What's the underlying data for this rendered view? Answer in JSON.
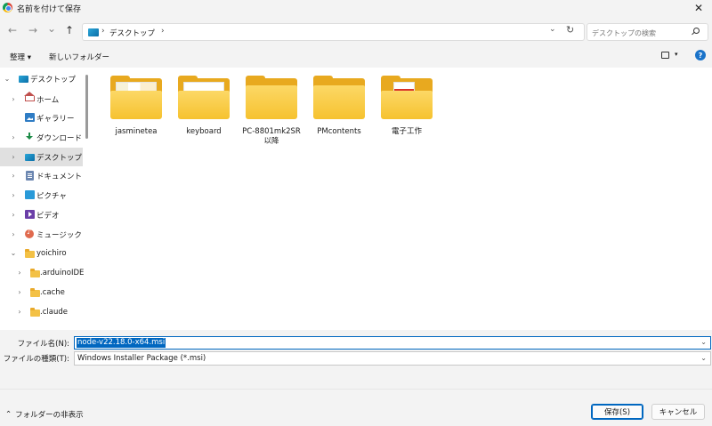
{
  "window": {
    "title": "名前を付けて保存",
    "close_glyph": "✕",
    "app_icon": "chrome-icon"
  },
  "nav": {
    "back_glyph": "←",
    "forward_glyph": "→",
    "recent_glyph": "⌄",
    "up_glyph": "↑",
    "address": {
      "separator": "›",
      "location": "デスクトップ"
    },
    "dropdown_glyph": "⌄",
    "refresh_glyph": "↻",
    "search_placeholder": "デスクトップの検索"
  },
  "toolbar": {
    "organize": "整理 ▾",
    "new_folder": "新しいフォルダー",
    "view_drop": "▾",
    "help": "?"
  },
  "sidebar": {
    "items": [
      {
        "label": "デスクトップ",
        "icon": "desktop-icon",
        "chevron": "⌄"
      },
      {
        "label": "ホーム",
        "icon": "home-icon",
        "chevron": "›"
      },
      {
        "label": "ギャラリー",
        "icon": "gallery-icon",
        "chevron": ""
      },
      {
        "label": "ダウンロード",
        "icon": "download-icon",
        "chevron": "›"
      },
      {
        "label": "デスクトップ",
        "icon": "desktop-icon",
        "chevron": "›"
      },
      {
        "label": "ドキュメント",
        "icon": "document-icon",
        "chevron": "›"
      },
      {
        "label": "ピクチャ",
        "icon": "pictures-icon",
        "chevron": "›"
      },
      {
        "label": "ビデオ",
        "icon": "video-icon",
        "chevron": "›"
      },
      {
        "label": "ミュージック",
        "icon": "music-icon",
        "chevron": "›"
      },
      {
        "label": "yoichiro",
        "icon": "folder-icon",
        "chevron": "⌄"
      },
      {
        "label": ".arduinoIDE",
        "icon": "folder-icon",
        "chevron": "›"
      },
      {
        "label": ".cache",
        "icon": "folder-icon",
        "chevron": "›"
      },
      {
        "label": ".claude",
        "icon": "folder-icon",
        "chevron": "›"
      }
    ]
  },
  "folders": [
    {
      "name": "jasminetea"
    },
    {
      "name": "keyboard"
    },
    {
      "name": "PC-8801mk2SR\n以降"
    },
    {
      "name": "PMcontents"
    },
    {
      "name": "電子工作"
    }
  ],
  "form": {
    "filename_label": "ファイル名(N):",
    "filename_value": "node-v22.18.0-x64.msi",
    "filetype_label": "ファイルの種類(T):",
    "filetype_value": "Windows Installer Package (*.msi)",
    "dropdown_glyph": "⌄"
  },
  "footer": {
    "hide_folders_glyph": "⌃",
    "hide_folders": "フォルダーの非表示",
    "save": "保存(S)",
    "cancel": "キャンセル"
  }
}
